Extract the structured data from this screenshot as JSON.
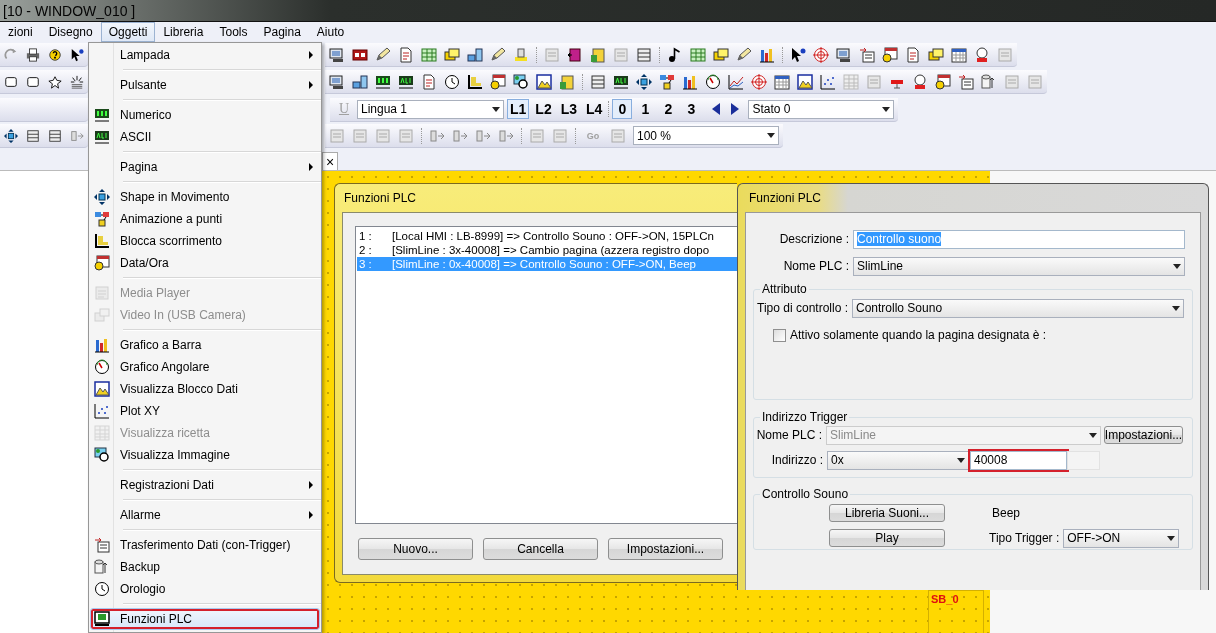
{
  "window": {
    "title": "[10 - WINDOW_010 ]"
  },
  "menubar": {
    "items": [
      {
        "label": "zioni",
        "selected": false
      },
      {
        "label": "Disegno",
        "selected": false
      },
      {
        "label": "Oggetti",
        "selected": true
      },
      {
        "label": "Libreria",
        "selected": false
      },
      {
        "label": "Tools",
        "selected": false
      },
      {
        "label": "Pagina",
        "selected": false
      },
      {
        "label": "Aiuto",
        "selected": false
      }
    ]
  },
  "toolbar": {
    "underline_button": {
      "label": "U",
      "disabled": true
    },
    "language": "Lingua 1",
    "layers": [
      {
        "label": "L1",
        "selected": true
      },
      {
        "label": "L2",
        "selected": false
      },
      {
        "label": "L3",
        "selected": false
      },
      {
        "label": "L4",
        "selected": false
      }
    ],
    "states": [
      {
        "label": "0",
        "selected": true
      },
      {
        "label": "1",
        "selected": false
      },
      {
        "label": "2",
        "selected": false
      },
      {
        "label": "3",
        "selected": false
      }
    ],
    "state_select": "Stato 0",
    "go_button": {
      "label": "Go",
      "disabled": true
    },
    "zoom": "100 %"
  },
  "tab_close": "×",
  "objects_menu": {
    "sections": [
      [
        {
          "label": "Lampada",
          "submenu": true,
          "disabled": false,
          "selected": false,
          "marked": false
        }
      ],
      [
        {
          "label": "Pulsante",
          "submenu": true,
          "disabled": false,
          "selected": false,
          "marked": false
        }
      ],
      [
        {
          "label": "Numerico",
          "submenu": false,
          "disabled": false,
          "selected": false,
          "marked": false
        },
        {
          "label": "ASCII",
          "submenu": false,
          "disabled": false,
          "selected": false,
          "marked": false
        }
      ],
      [
        {
          "label": "Pagina",
          "submenu": true,
          "disabled": false,
          "selected": false,
          "marked": false
        }
      ],
      [
        {
          "label": "Shape in Movimento",
          "submenu": false,
          "disabled": false,
          "selected": false,
          "marked": false
        },
        {
          "label": "Animazione a punti",
          "submenu": false,
          "disabled": false,
          "selected": false,
          "marked": false
        },
        {
          "label": "Blocca scorrimento",
          "submenu": false,
          "disabled": false,
          "selected": false,
          "marked": false
        },
        {
          "label": "Data/Ora",
          "submenu": false,
          "disabled": false,
          "selected": false,
          "marked": false
        }
      ],
      [
        {
          "label": "Media Player",
          "submenu": false,
          "disabled": true,
          "selected": false,
          "marked": false
        },
        {
          "label": "Video In (USB Camera)",
          "submenu": false,
          "disabled": true,
          "selected": false,
          "marked": false
        }
      ],
      [
        {
          "label": "Grafico a Barra",
          "submenu": false,
          "disabled": false,
          "selected": false,
          "marked": false
        },
        {
          "label": "Grafico Angolare",
          "submenu": false,
          "disabled": false,
          "selected": false,
          "marked": false
        },
        {
          "label": "Visualizza Blocco Dati",
          "submenu": false,
          "disabled": false,
          "selected": false,
          "marked": false
        },
        {
          "label": "Plot XY",
          "submenu": false,
          "disabled": false,
          "selected": false,
          "marked": false
        },
        {
          "label": "Visualizza ricetta",
          "submenu": false,
          "disabled": true,
          "selected": false,
          "marked": false
        },
        {
          "label": "Visualizza Immagine",
          "submenu": false,
          "disabled": false,
          "selected": false,
          "marked": false
        }
      ],
      [
        {
          "label": "Registrazioni Dati",
          "submenu": true,
          "disabled": false,
          "selected": false,
          "marked": false
        }
      ],
      [
        {
          "label": "Allarme",
          "submenu": true,
          "disabled": false,
          "selected": false,
          "marked": false
        }
      ],
      [
        {
          "label": "Trasferimento Dati (con-Trigger)",
          "submenu": false,
          "disabled": false,
          "selected": false,
          "marked": false
        },
        {
          "label": "Backup",
          "submenu": false,
          "disabled": false,
          "selected": false,
          "marked": false
        },
        {
          "label": "Orologio",
          "submenu": false,
          "disabled": false,
          "selected": false,
          "marked": false
        }
      ],
      [
        {
          "label": "Funzioni PLC",
          "submenu": false,
          "disabled": false,
          "selected": true,
          "marked": true
        }
      ]
    ]
  },
  "canvas": {
    "object_label": "SB_0"
  },
  "list_dialog": {
    "title": "Funzioni PLC",
    "rows": [
      {
        "number": "1 :",
        "text": "[Local HMI : LB-8999] => Controllo Souno : OFF->ON, 15PLCn",
        "selected": false
      },
      {
        "number": "2 :",
        "text": "[SlimLine : 3x-40008] => Cambio pagina (azzera registro dopo",
        "selected": false
      },
      {
        "number": "3 :",
        "text": "[SlimLine : 0x-40008] => Controllo Souno : OFF->ON, Beep",
        "selected": true
      }
    ],
    "buttons": [
      "Nuovo...",
      "Cancella",
      "Impostazioni..."
    ]
  },
  "edit_dialog": {
    "title": "Funzioni PLC",
    "description": {
      "label": "Descrizione :",
      "value": "Controllo suono",
      "value_selected": true
    },
    "plc_name": {
      "label": "Nome PLC :",
      "value": "SlimLine"
    },
    "attribute": {
      "legend": "Attributo",
      "control_type": {
        "label": "Tipo di controllo :",
        "value": "Controllo Souno"
      },
      "page_only": {
        "label": "Attivo solamente quando la pagina designata è :",
        "checked": false
      }
    },
    "trigger": {
      "legend": "Indirizzo Trigger",
      "plc_name": {
        "label": "Nome PLC :",
        "value": "SlimLine",
        "disabled": true
      },
      "settings_button": "Impostazioni...",
      "address": {
        "label": "Indirizzo :",
        "type": "0x",
        "value": "40008",
        "marked": true
      }
    },
    "sound": {
      "legend": "Controllo Souno",
      "library_button": "Libreria Suoni...",
      "sound_name": "Beep",
      "play_button": "Play",
      "trigger_type": {
        "label": "Tipo Trigger :",
        "value": "OFF->ON"
      }
    }
  }
}
